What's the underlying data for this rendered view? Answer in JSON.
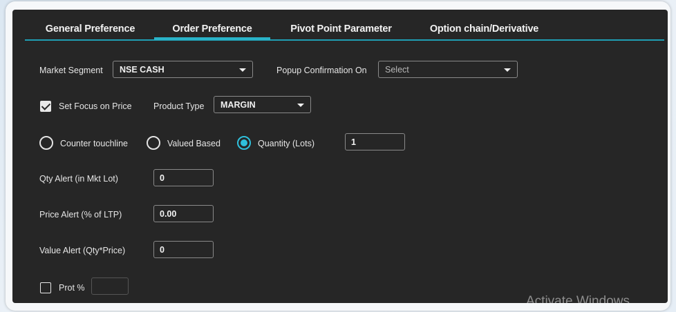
{
  "tabs": [
    {
      "label": "General Preference"
    },
    {
      "label": "Order Preference"
    },
    {
      "label": "Pivot Point Parameter"
    },
    {
      "label": "Option chain/Derivative"
    }
  ],
  "active_tab": "Order Preference",
  "accent_color": "#2ab3c8",
  "market_segment": {
    "label": "Market Segment",
    "value": "NSE CASH"
  },
  "popup_confirmation": {
    "label": "Popup Confirmation On",
    "placeholder": "Select"
  },
  "set_focus_price": {
    "label": "Set Focus on Price",
    "checked": true
  },
  "product_type": {
    "label": "Product Type",
    "value": "MARGIN"
  },
  "radio_options": [
    {
      "label": "Counter touchline",
      "selected": false
    },
    {
      "label": "Valued Based",
      "selected": false
    },
    {
      "label": "Quantity (Lots)",
      "selected": true
    }
  ],
  "quantity_lots_value": "1",
  "qty_alert": {
    "label": "Qty Alert (in Mkt Lot)",
    "value": "0"
  },
  "price_alert": {
    "label": "Price Alert (% of LTP)",
    "value": "0.00"
  },
  "value_alert": {
    "label": "Value Alert (Qty*Price)",
    "value": "0"
  },
  "prot": {
    "label": "Prot %",
    "checked": false,
    "value": ""
  },
  "watermark": "Activate Windows"
}
